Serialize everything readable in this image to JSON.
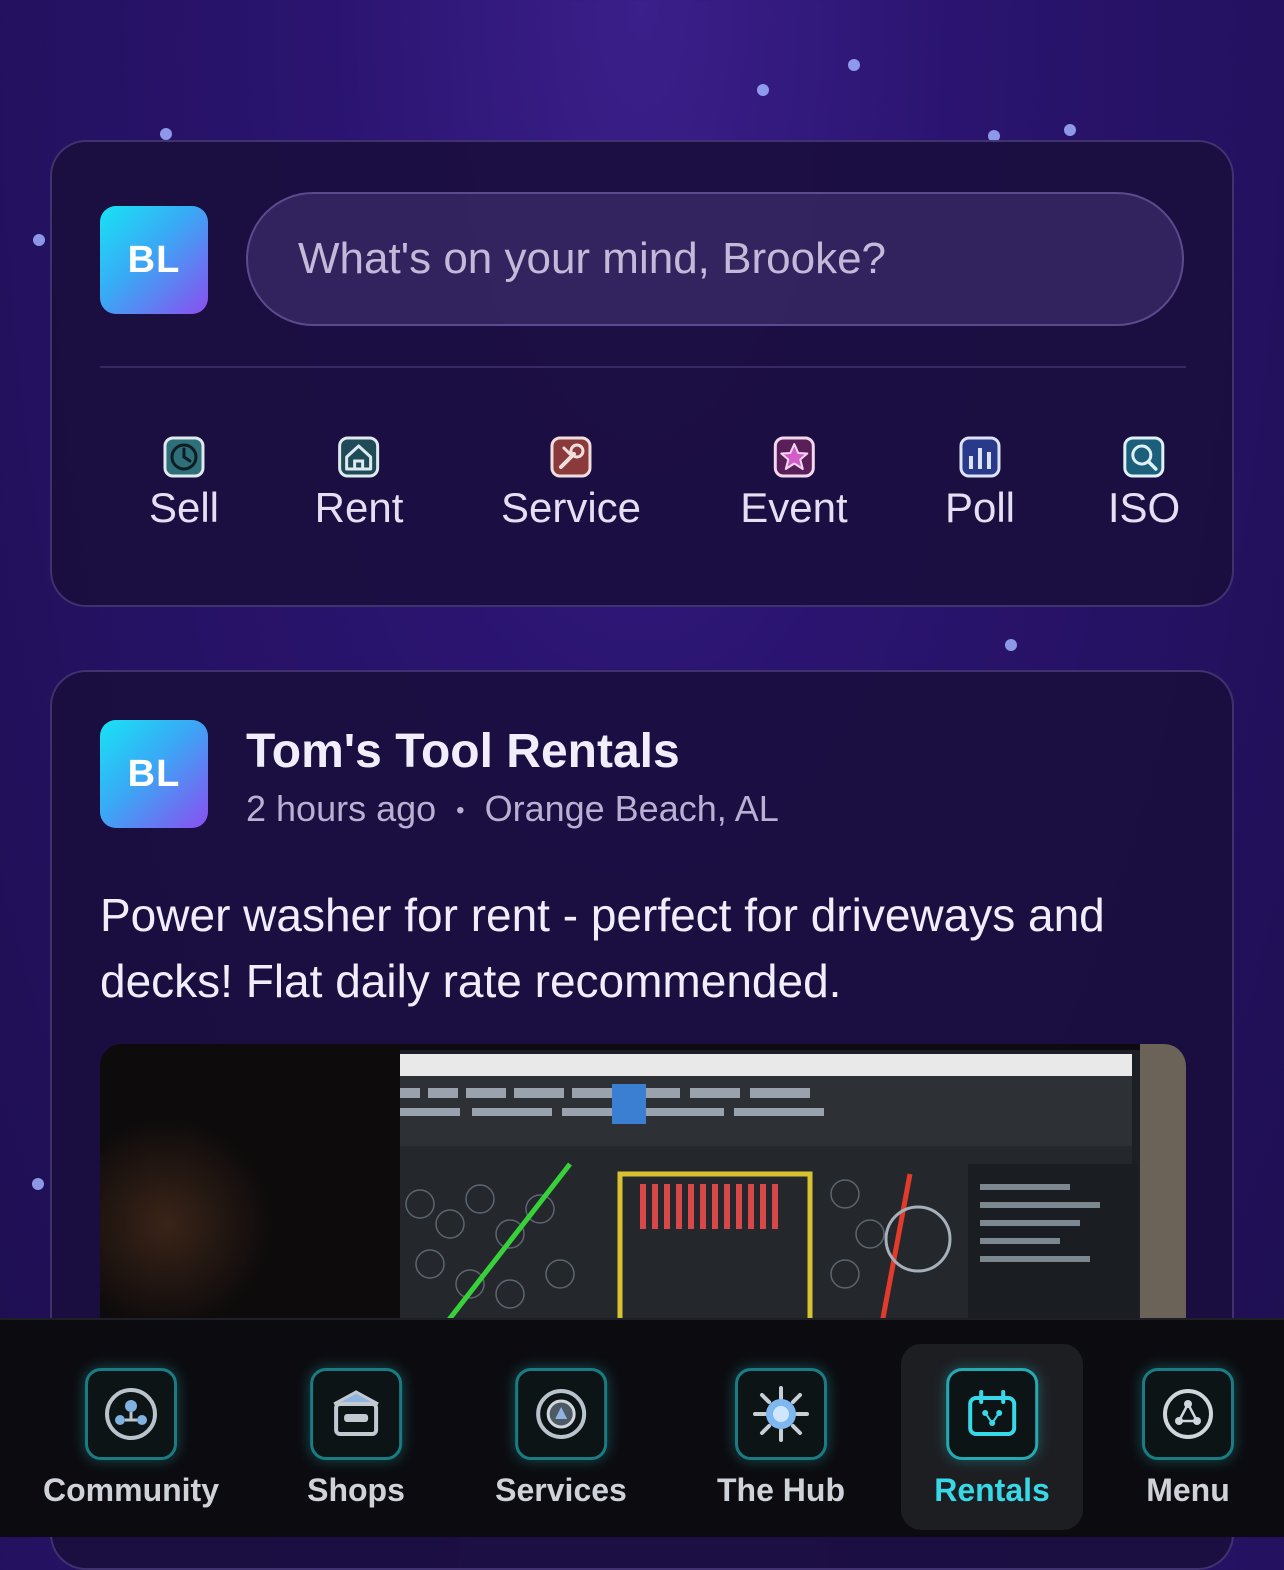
{
  "composer": {
    "avatar_initials": "BL",
    "placeholder": "What's on your mind, Brooke?",
    "actions": [
      {
        "label": "Sell",
        "icon": "clock-tag-icon",
        "color": "#5cc6d0"
      },
      {
        "label": "Rent",
        "icon": "house-icon",
        "color": "#5cc6d0"
      },
      {
        "label": "Service",
        "icon": "wrench-icon",
        "color": "#e08a8a"
      },
      {
        "label": "Event",
        "icon": "star-icon",
        "color": "#d35cc8"
      },
      {
        "label": "Poll",
        "icon": "bar-chart-icon",
        "color": "#6a8af0"
      },
      {
        "label": "ISO",
        "icon": "magnifier-icon",
        "color": "#3fb8e0"
      }
    ]
  },
  "post": {
    "avatar_initials": "BL",
    "title": "Tom's Tool Rentals",
    "time": "2 hours ago",
    "separator": "•",
    "location": "Orange Beach, AL",
    "body": "Power washer for rent - perfect for driveways and decks! Flat daily rate recommended.",
    "image_icon": "cad-screen-photo"
  },
  "navbar": {
    "active": "Rentals",
    "accent_color": "#37d9e8",
    "items": [
      {
        "label": "Community",
        "icon": "community-icon"
      },
      {
        "label": "Shops",
        "icon": "shop-icon"
      },
      {
        "label": "Services",
        "icon": "services-icon"
      },
      {
        "label": "The Hub",
        "icon": "hub-icon"
      },
      {
        "label": "Rentals",
        "icon": "rentals-icon"
      },
      {
        "label": "Menu",
        "icon": "menu-icon"
      }
    ]
  }
}
